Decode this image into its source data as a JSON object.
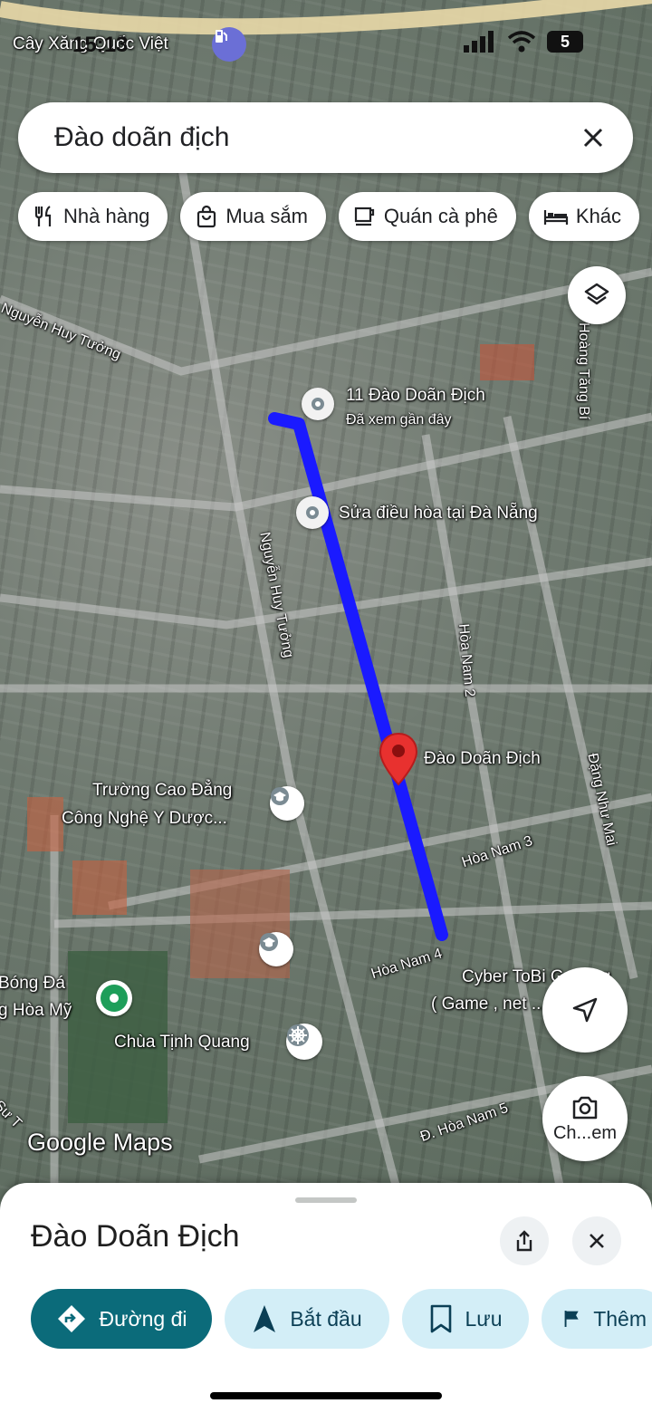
{
  "status_bar": {
    "time": "15:13",
    "battery": "5"
  },
  "search": {
    "query": "Đào doãn địch"
  },
  "chips": [
    {
      "icon": "fork-knife-icon",
      "label": "Nhà hàng"
    },
    {
      "icon": "shopping-bag-icon",
      "label": "Mua sắm"
    },
    {
      "icon": "coffee-cup-icon",
      "label": "Quán cà phê"
    },
    {
      "icon": "bed-icon",
      "label": "Khác"
    }
  ],
  "map": {
    "top_poi": "Cây Xăng Quốc Việt",
    "streets": {
      "nguyen_huy_tuong_1": "Nguyễn Huy Tưởng",
      "nguyen_huy_tuong_2": "Nguyễn Huy Tưởng",
      "hoang_tang_bi": "Hoàng Tăng Bí",
      "hoa_nam_2": "Hòa Nam 2",
      "hoa_nam_3": "Hòa Nam 3",
      "hoa_nam_4": "Hòa Nam 4",
      "hoa_nam_5": "Đ. Hòa Nam 5",
      "dang_nhu_mai": "Đặng Như Mai",
      "su_t": "Sư T"
    },
    "places": {
      "p1_name": "11 Đào Doãn Địch",
      "p1_sub": "Đã xem gần đây",
      "p2_name": "Sửa điều hòa tại Đà Nẵng",
      "selected": "Đào Doãn Địch",
      "college_1": "Trường Cao Đẳng",
      "college_2": "Công Nghệ Y Dược...",
      "cyber_1": "Cyber ToBi Gaming",
      "cyber_2": "( Game , net ...",
      "football_1": "Bóng Đá",
      "football_2": "g Hòa Mỹ",
      "pagoda": "Chùa Tịnh Quang"
    },
    "watermark": "Google Maps",
    "camera_label": "Ch...em",
    "route_color": "#1a1aff"
  },
  "sheet": {
    "title": "Đào Doãn Địch",
    "actions": [
      {
        "icon": "directions-icon",
        "label": "Đường đi"
      },
      {
        "icon": "navigation-arrow-icon",
        "label": "Bắt đầu"
      },
      {
        "icon": "bookmark-icon",
        "label": "Lưu"
      },
      {
        "icon": "flag-icon",
        "label": "Thêm"
      }
    ]
  }
}
